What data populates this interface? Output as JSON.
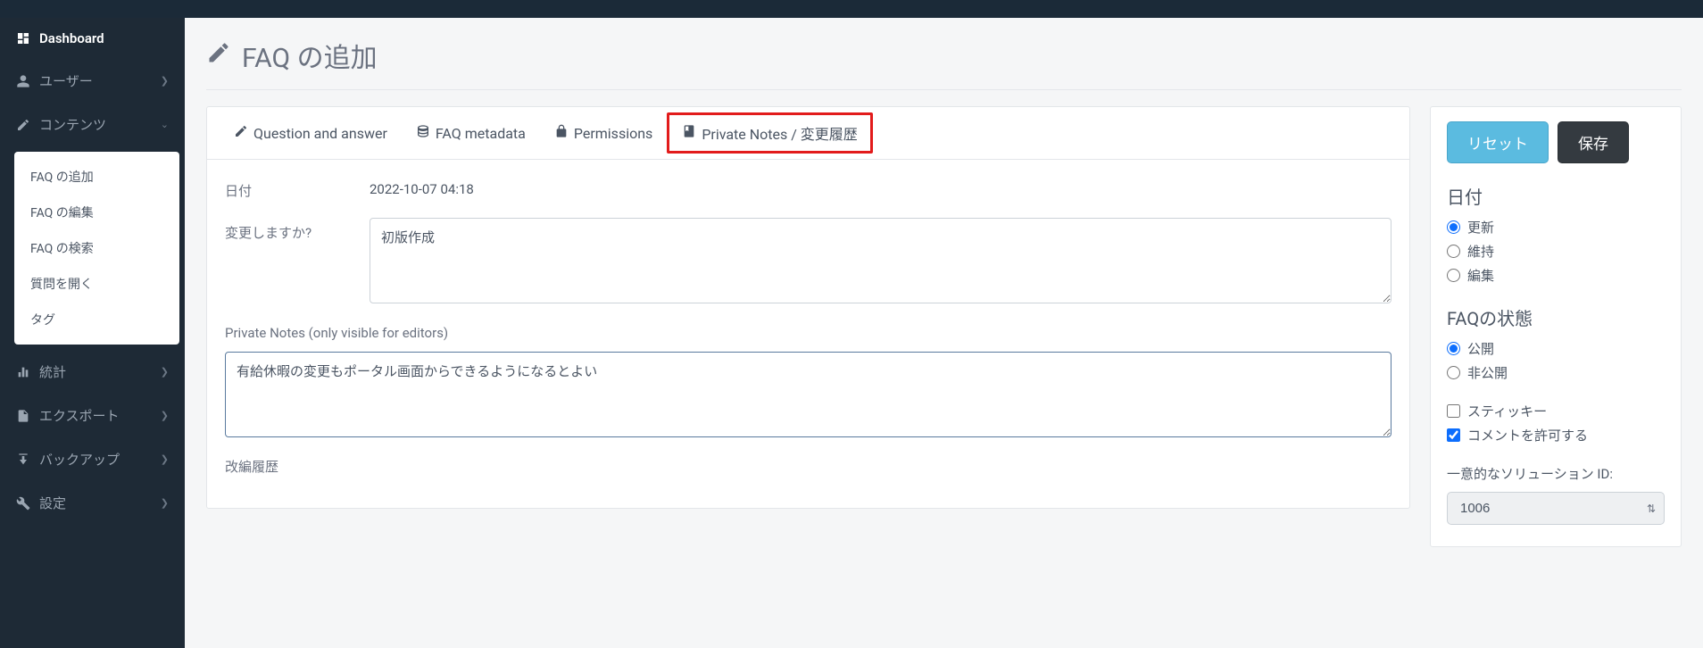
{
  "sidebar": {
    "dashboard": "Dashboard",
    "users": "ユーザー",
    "contents": "コンテンツ",
    "sub": {
      "add": "FAQ の追加",
      "edit": "FAQ の編集",
      "search": "FAQ の検索",
      "open_q": "質問を開く",
      "tag": "タグ"
    },
    "stats": "統計",
    "export": "エクスポート",
    "backup": "バックアップ",
    "settings": "設定"
  },
  "page": {
    "title": "FAQ の追加"
  },
  "tabs": {
    "qa": "Question and answer",
    "meta": "FAQ metadata",
    "perm": "Permissions",
    "notes": "Private Notes / 変更履歴"
  },
  "form": {
    "date_label": "日付",
    "date_value": "2022-10-07 04:18",
    "change_label": "変更しますか?",
    "change_value": "初版作成",
    "private_label": "Private Notes (only visible for editors)",
    "private_value": "有給休暇の変更もポータル画面からできるようになるとよい",
    "history_label": "改編履歴"
  },
  "side": {
    "reset": "リセット",
    "save": "保存",
    "date_heading": "日付",
    "radios": {
      "update": "更新",
      "keep": "維持",
      "edit": "編集"
    },
    "state_heading": "FAQの状態",
    "state": {
      "public": "公開",
      "private": "非公開"
    },
    "sticky": "スティッキー",
    "allow_comments": "コメントを許可する",
    "solution_label": "一意的なソリューション ID:",
    "solution_value": "1006"
  }
}
